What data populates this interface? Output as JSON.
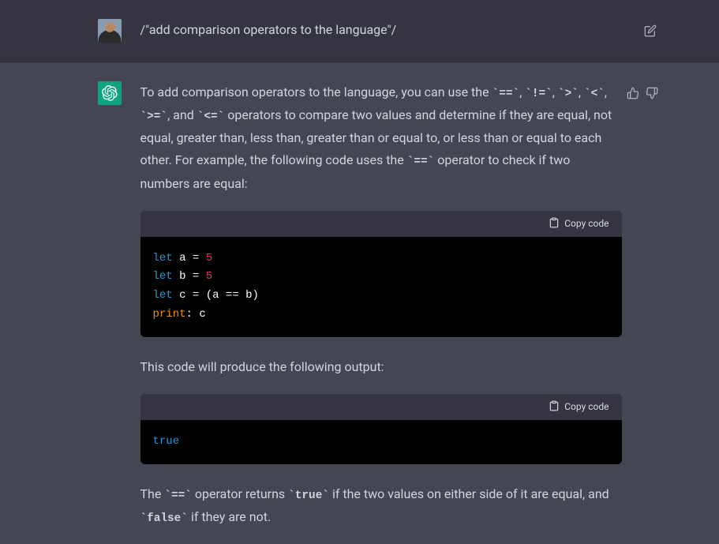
{
  "user": {
    "message": "/\"add comparison operators to the language\"/"
  },
  "assistant": {
    "p1_a": "To add comparison operators to the language, you can use the ",
    "p1_ops": [
      "==",
      "!=",
      ">",
      "<",
      ">=",
      "<="
    ],
    "p1_sep1": ", ",
    "p1_sep_last": ", and ",
    "p1_b": " operators to compare two values and determine if they are equal, not equal, greater than, less than, greater than or equal to, or less than or equal to each other. For example, the following code uses the ",
    "p1_op_example": "==",
    "p1_c": " operator to check if two numbers are equal:",
    "copy_label": "Copy code",
    "code1": {
      "l1_kw": "let",
      "l1_rest": " a = ",
      "l1_num": "5",
      "l2_kw": "let",
      "l2_rest": " b = ",
      "l2_num": "5",
      "l3_kw": "let",
      "l3_rest": " c = (a == b)",
      "l4_fn": "print",
      "l4_rest": ": c"
    },
    "p2": "This code will produce the following output:",
    "code2": {
      "l1": "true"
    },
    "p3_a": "The ",
    "p3_op": "==",
    "p3_b": " operator returns ",
    "p3_true": "true",
    "p3_c": " if the two values on either side of it are equal, and ",
    "p3_false": "false",
    "p3_d": " if they are not."
  },
  "icons": {
    "edit": "edit-icon",
    "thumbs_up": "thumbs-up-icon",
    "thumbs_down": "thumbs-down-icon",
    "clipboard": "clipboard-icon"
  }
}
